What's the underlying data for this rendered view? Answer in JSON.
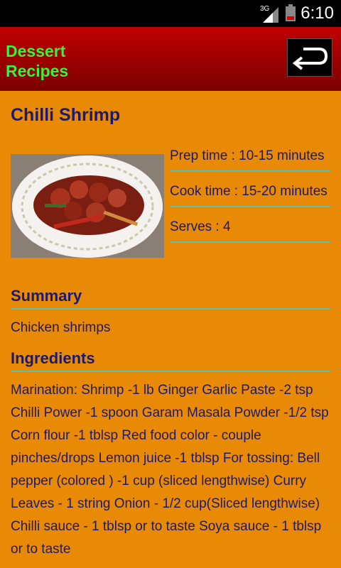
{
  "status": {
    "time": "6:10",
    "network": "3G"
  },
  "app": {
    "title": "Dessert Recipes",
    "back_icon": "back-arrow-icon"
  },
  "recipe": {
    "name": "Chilli Shrimp",
    "prep": "Prep time : 10-15 minutes",
    "cook": "Cook time : 15-20 minutes",
    "serves": "Serves : 4",
    "summary_heading": "Summary",
    "summary": "Chicken shrimps",
    "ingredients_heading": "Ingredients",
    "ingredients": "Marination: Shrimp -1 lb Ginger Garlic Paste -2 tsp Chilli Power -1 spoon Garam Masala Powder -1/2 tsp Corn flour -1 tblsp Red food color - couple pinches/drops Lemon juice -1 tblsp For tossing: Bell pepper (colored ) -1 cup (sliced lengthwise) Curry Leaves - 1 string Onion - 1/2 cup(Sliced lengthwise) Chilli sauce - 1 tblsp or to taste Soya sauce - 1 tblsp or to taste"
  }
}
